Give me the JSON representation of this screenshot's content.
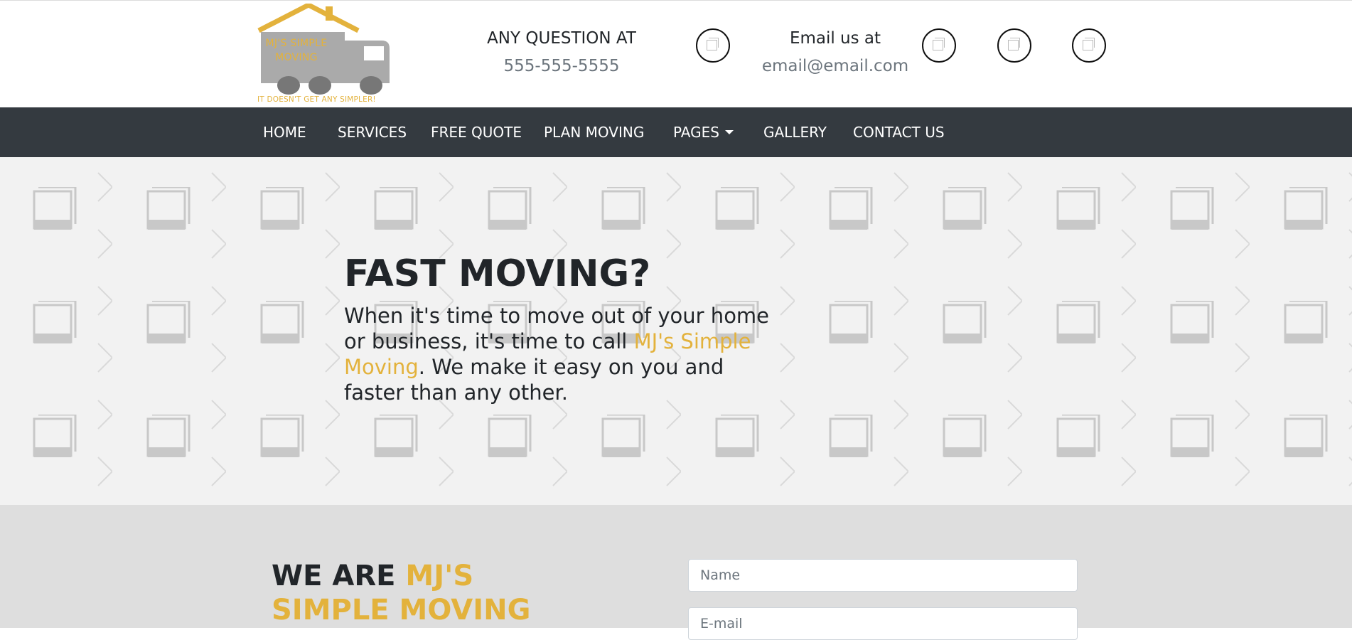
{
  "logo": {
    "line1": "MJ'S SIMPLE",
    "line2": "MOVING",
    "tagline": "IT DOESN'T GET ANY SIMPLER!"
  },
  "contact": {
    "phone_label": "ANY QUESTION AT",
    "phone_value": "555-555-5555",
    "email_label": "Email us at",
    "email_value": "email@email.com"
  },
  "social_icons": [
    "image-icon",
    "image-icon",
    "image-icon",
    "image-icon"
  ],
  "nav": {
    "items": [
      "HOME",
      "SERVICES",
      "FREE QUOTE",
      "PLAN MOVING",
      "PAGES",
      "GALLERY",
      "CONTACT US"
    ]
  },
  "hero": {
    "title": "FAST MOVING?",
    "text_before": "When it's time to move out of your home or business, it's time to call ",
    "text_highlight": "MJ's Simple Moving",
    "text_after": ". We make it easy on you and faster than any other."
  },
  "about": {
    "title_prefix": "WE ARE ",
    "title_highlight": "MJ'S SIMPLE MOVING"
  },
  "form": {
    "name_placeholder": "Name",
    "email_placeholder": "E-mail"
  },
  "colors": {
    "accent": "#e3b23c",
    "navbar_bg": "#343a40",
    "hero_bg": "#f2f2f2",
    "about_bg": "#dedede"
  }
}
